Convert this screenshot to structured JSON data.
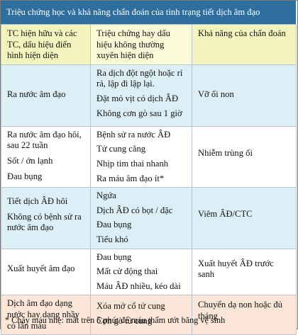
{
  "title": "Triệu chứng học và khả năng chẩn đoán của tình trạng tiết dịch âm đạo",
  "header": {
    "col1": "TC hiện hữu và các TC, dấu hiệu điển hình hiện diện",
    "col2": "Triệu chứng hay dấu hiệu không thường xuyên hiện diện",
    "col3": "Khả năng của chẩn đoán"
  },
  "rows": [
    {
      "col1": [
        "Ra nước âm đạo"
      ],
      "col2": [
        "Ra dịch đột ngột hoặc rỉ rả, lập đi lập lại.",
        "Đặt mỏ vịt có dịch ÂĐ",
        "Không cơn gò sau 1 giờ"
      ],
      "col3": "Vỡ ối non"
    },
    {
      "col1": [
        "Ra nước âm đạo hôi, sau 22 tuần",
        "Sốt / ớn lạnh",
        "Đau bụng"
      ],
      "col2": [
        "Bệnh sử ra nước ÂĐ",
        "Tử cung căng",
        "Nhịp tim thai nhanh",
        "Ra máu âm đạo ít*"
      ],
      "col3": "Nhiễm trùng ối"
    },
    {
      "col1": [
        "Tiết dịch ÂĐ hôi",
        "Không có bệnh sử ra nước âm đạo"
      ],
      "col2": [
        "Ngứa",
        "Dịch ÂĐ có bọt / đặc",
        "Đau bụng",
        "Tiểu khó"
      ],
      "col3": "Viêm ÂĐ/CTC"
    },
    {
      "col1": [
        "Xuất huyết âm đạo"
      ],
      "col2": [
        "Đau bụng",
        "Mất cử động thai",
        "Máu ÂĐ nhiều, kéo dài"
      ],
      "col3": "Xuất huyết ÂĐ trước sanh"
    },
    {
      "col1": [
        "Dịch âm đạo dạng nước hay dạng nhầy có lẫn máu"
      ],
      "col2": [
        "Xóa mở cổ tử cung",
        "Cơn gò tử cung"
      ],
      "col3": "Chuyển dạ non hoặc đủ tháng"
    }
  ],
  "footnote": "* Chảy máu nhẹ: mất trên 5 phút để máu thấm ướt băng vệ sinh"
}
